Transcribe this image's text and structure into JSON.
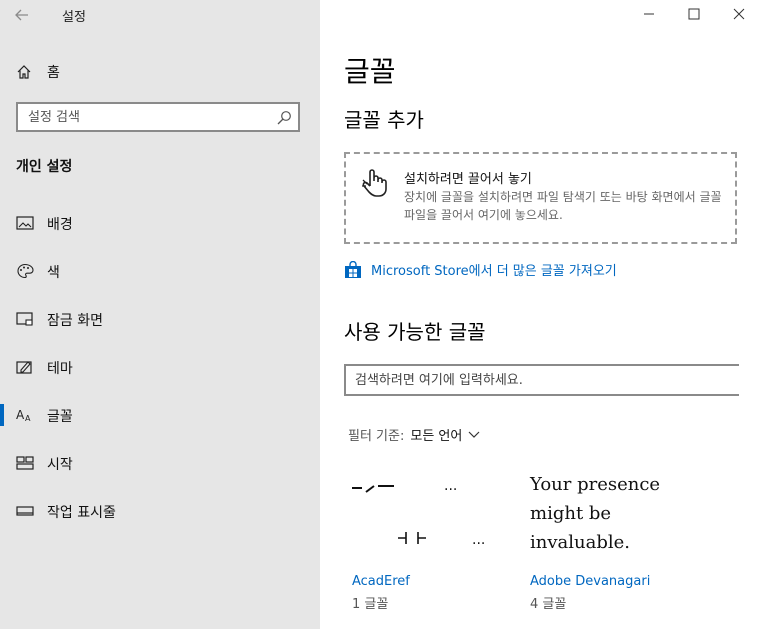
{
  "window": {
    "title": "설정"
  },
  "sidebar": {
    "home_label": "홈",
    "search_placeholder": "설정 검색",
    "section_title": "개인 설정",
    "items": [
      {
        "label": "배경",
        "icon": "image-icon"
      },
      {
        "label": "색",
        "icon": "palette-icon"
      },
      {
        "label": "잠금 화면",
        "icon": "lock-screen-icon"
      },
      {
        "label": "테마",
        "icon": "theme-icon"
      },
      {
        "label": "글꼴",
        "icon": "font-icon",
        "active": true
      },
      {
        "label": "시작",
        "icon": "start-icon"
      },
      {
        "label": "작업 표시줄",
        "icon": "taskbar-icon"
      }
    ]
  },
  "main": {
    "title": "글꼴",
    "add_title": "글꼴 추가",
    "drop_title": "설치하려면 끌어서 놓기",
    "drop_desc": "장치에 글꼴을 설치하려면 파일 탐색기 또는 바탕 화면에서 글꼴 파일을 끌어서 여기에 놓으세요.",
    "store_link": "Microsoft Store에서 더 많은 글꼴 가져오기",
    "available_title": "사용 가능한 글꼴",
    "font_search_placeholder": "검색하려면 여기에 입력하세요.",
    "filter_label": "필터 기준:",
    "filter_value": "모든 언어",
    "fonts": [
      {
        "name": "AcadEref",
        "count": "1 글꼴",
        "preview_dots": "...",
        "preview_dots2": "..."
      },
      {
        "name": "Adobe Devanagari",
        "count": "4 글꼴",
        "preview_lines": [
          "Your presence",
          "might be",
          "invaluable."
        ]
      }
    ]
  },
  "colors": {
    "accent": "#0067c0",
    "sidebar_bg": "#e6e6e6"
  }
}
